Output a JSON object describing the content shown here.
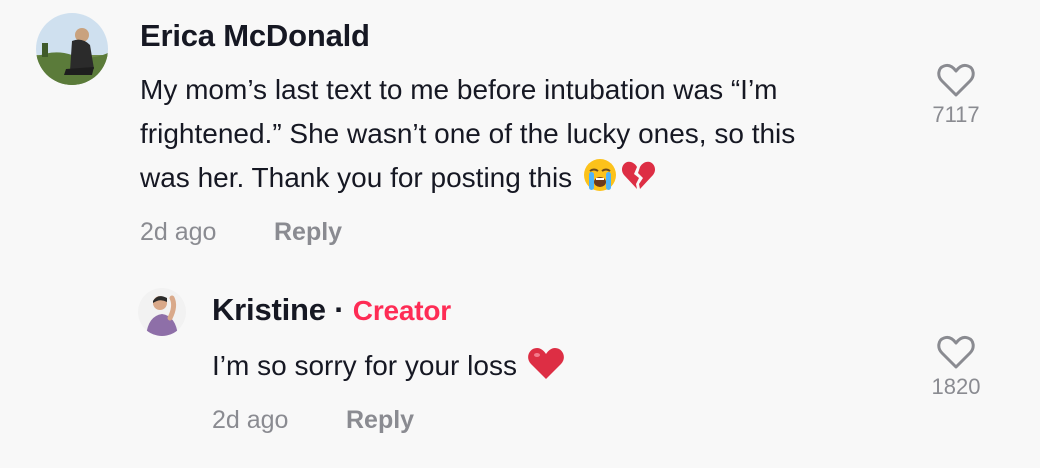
{
  "comments": [
    {
      "author": "Erica McDonald",
      "text_line1": "My mom’s last text to me before intubation was “I’m",
      "text_line2": "frightened.” She wasn’t one of the lucky ones, so this",
      "text_line3": "was her. Thank you for posting this",
      "emojis": [
        "loudly-crying-face-icon",
        "broken-heart-icon"
      ],
      "time": "2d ago",
      "reply_label": "Reply",
      "likes": "7117"
    }
  ],
  "reply": {
    "author": "Kristine",
    "separator": "·",
    "badge": "Creator",
    "text": "I’m so sorry for your loss",
    "emojis": [
      "red-heart-icon"
    ],
    "time": "2d ago",
    "reply_label": "Reply",
    "likes": "1820"
  },
  "colors": {
    "background": "#f8f8f8",
    "text": "#161823",
    "muted": "#8a8b91",
    "creator_badge": "#fe2c55"
  }
}
